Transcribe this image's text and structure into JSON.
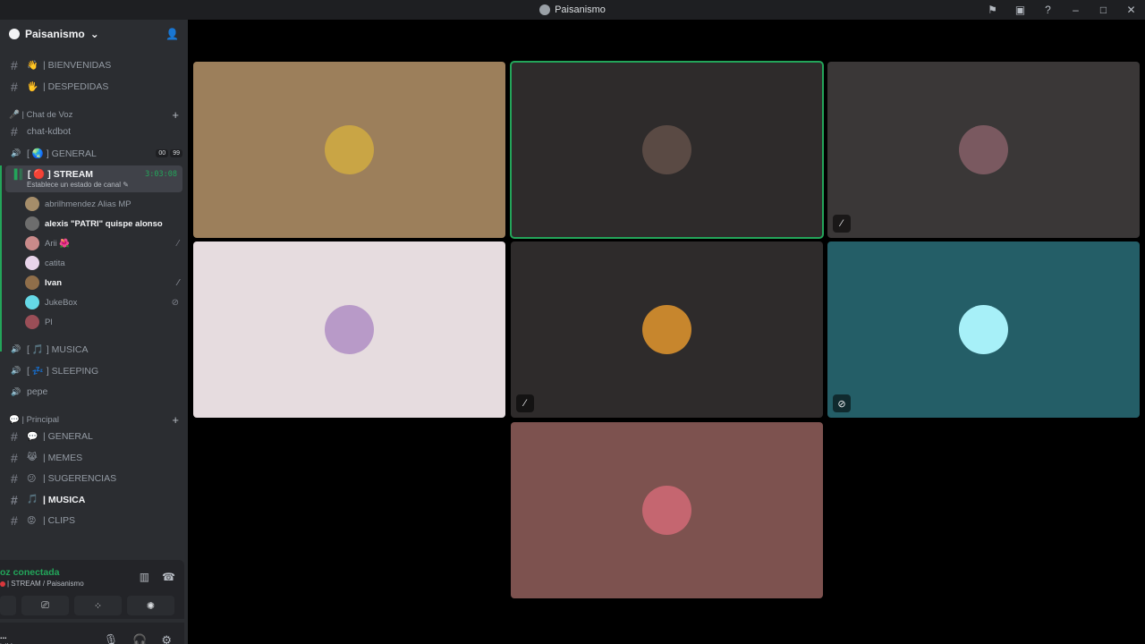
{
  "window": {
    "title": "Paisanismo",
    "controls": [
      "flag-icon",
      "inbox-icon",
      "help-icon",
      "minimize-icon",
      "maximize-icon",
      "close-icon"
    ]
  },
  "server": {
    "name": "Paisanismo"
  },
  "channels_top": [
    {
      "emoji": "👋",
      "name": "| BIENVENIDAS",
      "icon": "rules-icon"
    },
    {
      "emoji": "🖐",
      "name": "| DESPEDIDAS",
      "icon": "hash-icon"
    }
  ],
  "voice_category": {
    "label": "🎤 | Chat de Voz"
  },
  "voice_channels": [
    {
      "name": "chat-kdbot",
      "icon": "hash-icon"
    },
    {
      "name": "[ 🌏 ] GENERAL",
      "icon": "speaker-icon",
      "badges": [
        "00",
        "99"
      ]
    }
  ],
  "active_channel": {
    "name": "[ 🔴 ] STREAM",
    "timer": "3:03:08",
    "status_hint": "Establece un estado de canal"
  },
  "voice_users": [
    {
      "name": "abrilhmendez Alias MP",
      "color": "#a58d6a",
      "muted": false,
      "bold": false
    },
    {
      "name": "alexis \"PATRI\" quispe alonso",
      "color": "#6d6d6d",
      "muted": false,
      "bold": true
    },
    {
      "name": "Arii 🌺",
      "color": "#c98a8a",
      "muted": true,
      "bold": false
    },
    {
      "name": "catita",
      "color": "#e8d4ea",
      "muted": false,
      "bold": false
    },
    {
      "name": "Ivan",
      "color": "#8f6e4a",
      "muted": true,
      "bold": true
    },
    {
      "name": "JukeBox",
      "color": "#65d8e6",
      "muted": true,
      "bold": false
    },
    {
      "name": "Pl",
      "color": "#9a4e57",
      "muted": false,
      "bold": false
    }
  ],
  "voice_channels_after": [
    {
      "name": "[ 🎵 ] MUSICA",
      "icon": "speaker-icon"
    },
    {
      "name": "[ 💤 ] SLEEPING",
      "icon": "speaker-icon"
    },
    {
      "name": "pepe",
      "icon": "speaker-locked-icon"
    }
  ],
  "principal_category": {
    "label": "💬 | Principal"
  },
  "text_channels": [
    {
      "emoji": "💬",
      "name": "| GENERAL",
      "bold": false
    },
    {
      "emoji": "😹",
      "name": "| MEMES",
      "bold": false
    },
    {
      "emoji": "😕",
      "name": "| SUGERENCIAS",
      "bold": false
    },
    {
      "emoji": "🎵",
      "name": "| MUSICA",
      "bold": true
    },
    {
      "emoji": "😡",
      "name": "| CLIPS",
      "bold": false
    }
  ],
  "voice_panel": {
    "status": "oz conectada",
    "location": "| STREAM / Paisanismo"
  },
  "user_panel": {
    "name": "...",
    "status": "isible"
  },
  "tiles": [
    {
      "bg": "#9c7f5b",
      "avatar": "#c9a545",
      "indicator": "",
      "speaking": false
    },
    {
      "bg": "#2e2b2b",
      "avatar": "#5a4a44",
      "indicator": "",
      "speaking": true
    },
    {
      "bg": "#3a3737",
      "avatar": "#7a5960",
      "indicator": "muted-icon",
      "speaking": false
    },
    {
      "bg": "#e6dcdf",
      "avatar": "#b89ac8",
      "indicator": "",
      "speaking": false
    },
    {
      "bg": "#2e2b2b",
      "avatar": "#c7862d",
      "indicator": "muted-icon",
      "speaking": false
    },
    {
      "bg": "#245e67",
      "avatar": "#a7f0f8",
      "indicator": "deafened-icon",
      "speaking": false
    },
    {
      "bg": "#7d524f",
      "avatar": "#c56670",
      "indicator": "",
      "speaking": false
    }
  ]
}
